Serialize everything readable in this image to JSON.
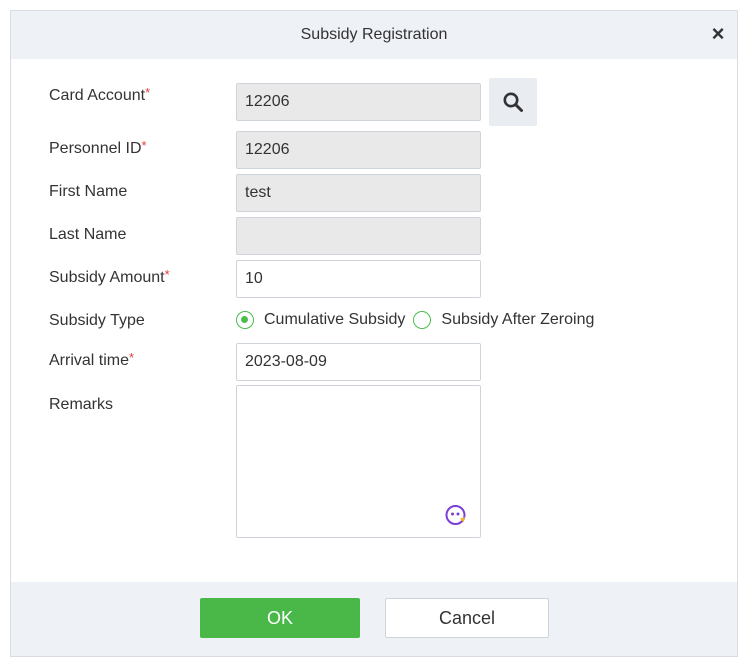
{
  "dialog": {
    "title": "Subsidy Registration",
    "close_symbol": "×"
  },
  "form": {
    "card_account": {
      "label": "Card Account",
      "required_mark": "*",
      "value": "12206"
    },
    "personnel_id": {
      "label": "Personnel ID",
      "required_mark": "*",
      "value": "12206"
    },
    "first_name": {
      "label": "First Name",
      "value": "test"
    },
    "last_name": {
      "label": "Last Name",
      "value": ""
    },
    "subsidy_amount": {
      "label": "Subsidy Amount",
      "required_mark": "*",
      "value": "10"
    },
    "subsidy_type": {
      "label": "Subsidy Type",
      "options": [
        {
          "label": "Cumulative Subsidy",
          "checked": true
        },
        {
          "label": "Subsidy After Zeroing",
          "checked": false
        }
      ]
    },
    "arrival_time": {
      "label": "Arrival time",
      "required_mark": "*",
      "value": "2023-08-09"
    },
    "remarks": {
      "label": "Remarks",
      "value": ""
    }
  },
  "icons": {
    "search": "search-icon",
    "emoji": "emoji-icon",
    "close": "close-icon"
  },
  "colors": {
    "accent": "#49b849",
    "required": "#e23c3c",
    "header_bg": "#eef1f6",
    "readonly_bg": "#e9e9e9"
  },
  "buttons": {
    "ok": "OK",
    "cancel": "Cancel"
  }
}
